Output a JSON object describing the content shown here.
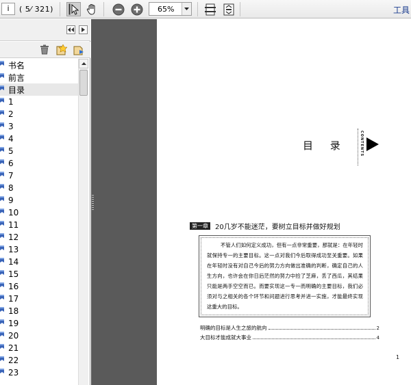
{
  "toolbar": {
    "page_input": "i",
    "page_count": "( 5⁄ 321)",
    "zoom": "65%",
    "tools_label": "工具"
  },
  "nav": {
    "bookmarks": [
      {
        "label": "书名"
      },
      {
        "label": "前言"
      },
      {
        "label": "目录",
        "selected": true
      },
      {
        "label": "1"
      },
      {
        "label": "2"
      },
      {
        "label": "3"
      },
      {
        "label": "4"
      },
      {
        "label": "5"
      },
      {
        "label": "6"
      },
      {
        "label": "7"
      },
      {
        "label": "8"
      },
      {
        "label": "9"
      },
      {
        "label": "10"
      },
      {
        "label": "11"
      },
      {
        "label": "12"
      },
      {
        "label": "13"
      },
      {
        "label": "14"
      },
      {
        "label": "15"
      },
      {
        "label": "16"
      },
      {
        "label": "17"
      },
      {
        "label": "18"
      },
      {
        "label": "19"
      },
      {
        "label": "20"
      },
      {
        "label": "21"
      },
      {
        "label": "22"
      },
      {
        "label": "23"
      }
    ]
  },
  "document": {
    "title": "目 录",
    "contents_label": "CONTENTS",
    "chapter_badge": "第一章",
    "chapter_title": "20几岁不能迷茫，要树立目标并做好规划",
    "summary": "不管人们如何定义成功，但有一点非常重要，那就是：在年轻时就保持专一的主要目标。这一点对我们今后取得成功至关重要。如果在年轻时没有对自己今后的努力方向做出准确的判断，确定自己的人生方向，也许会在你日后茫然的努力中捡了芝麻，丢了西瓜，其结果只能是两手空空而已。而要实现这一专一而明确的主要目标，我们必须对与之相关的各个环节和问题进行思考并进一实施，才能最终实现这重大的目标。",
    "toc": [
      {
        "title": "明确的目标是人生之旅的航向",
        "page": "2"
      },
      {
        "title": "大目标才能成就大事业",
        "page": "4"
      }
    ],
    "page_number": "1"
  },
  "colors": {
    "workspace": "#5a5a5a",
    "tools_link": "#1a3c8f",
    "bookmark_icon": "#3a64b8"
  }
}
